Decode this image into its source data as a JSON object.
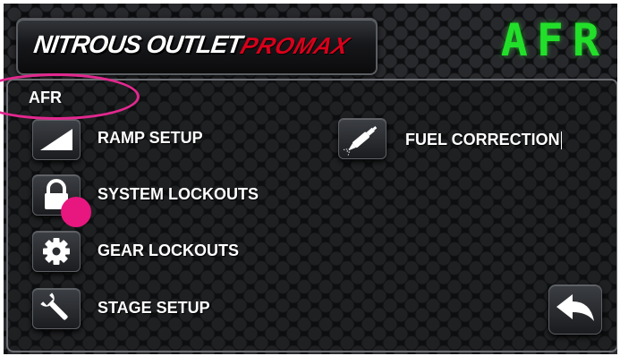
{
  "header": {
    "logo_main": "NITROUS OUTLET",
    "logo_sub": "PROMAX",
    "display_value": "AFR"
  },
  "panel": {
    "title": "AFR"
  },
  "menu": {
    "ramp_setup": "RAMP SETUP",
    "system_lockouts": "SYSTEM LOCKOUTS",
    "gear_lockouts": "GEAR LOCKOUTS",
    "stage_setup": "STAGE SETUP",
    "fuel_correction": "FUEL CORRECTION"
  },
  "icons": {
    "ramp": "ramp-icon",
    "lock": "lock-icon",
    "gear": "gear-icon",
    "wrench": "wrench-icon",
    "injector": "fuel-injector-icon",
    "back": "back-arrow-icon"
  },
  "colors": {
    "display_green": "#22e02a",
    "logo_red": "#d9001b",
    "annotation_pink": "#e3288f"
  }
}
